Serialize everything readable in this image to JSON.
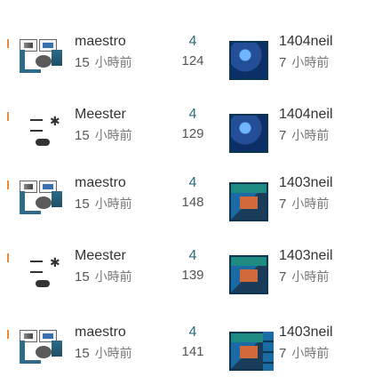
{
  "rows": [
    {
      "user": {
        "name": "maestro",
        "value": "15",
        "unit": "小時前"
      },
      "numbers": {
        "a": "4",
        "b": "124"
      },
      "game": {
        "title": "1404neil",
        "value": "7",
        "unit": "小時前"
      }
    },
    {
      "user": {
        "name": "Meester",
        "value": "15",
        "unit": "小時前"
      },
      "numbers": {
        "a": "4",
        "b": "129"
      },
      "game": {
        "title": "1404neil",
        "value": "7",
        "unit": "小時前"
      }
    },
    {
      "user": {
        "name": "maestro",
        "value": "15",
        "unit": "小時前"
      },
      "numbers": {
        "a": "4",
        "b": "148"
      },
      "game": {
        "title": "1403neil",
        "value": "7",
        "unit": "小時前"
      }
    },
    {
      "user": {
        "name": "Meester",
        "value": "15",
        "unit": "小時前"
      },
      "numbers": {
        "a": "4",
        "b": "139"
      },
      "game": {
        "title": "1403neil",
        "value": "7",
        "unit": "小時前"
      }
    },
    {
      "user": {
        "name": "maestro",
        "value": "15",
        "unit": "小時前"
      },
      "numbers": {
        "a": "4",
        "b": "141"
      },
      "game": {
        "title": "1403neil",
        "value": "7",
        "unit": "小時前"
      }
    }
  ],
  "icons": {
    "tick": "row-tick",
    "user_avatar": "user-avatar-icon",
    "dog_avatar": "meester-avatar-icon",
    "game_thumb": "game-thumbnail"
  }
}
